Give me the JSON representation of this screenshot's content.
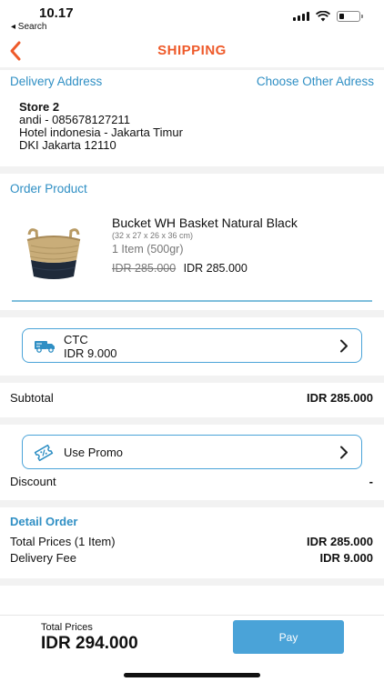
{
  "status_bar": {
    "time": "10.17",
    "back_app": "◂ Search"
  },
  "nav": {
    "title": "SHIPPING"
  },
  "delivery": {
    "section_label": "Delivery Address",
    "change_link": "Choose Other Adress",
    "store_name": "Store 2",
    "contact": "andi - 085678127211",
    "address_line1": "Hotel indonesia - Jakarta Timur",
    "address_line2": "DKI Jakarta 12110"
  },
  "order": {
    "section_label": "Order Product",
    "product": {
      "name": "Bucket WH Basket Natural Black",
      "dimensions": "(32 x 27 x 26 x 36 cm)",
      "quantity": "1 Item (500gr)",
      "original_price": "IDR 285.000",
      "price": "IDR 285.000"
    }
  },
  "courier": {
    "name": "CTC",
    "cost": "IDR 9.000"
  },
  "subtotal": {
    "label": "Subtotal",
    "value": "IDR 285.000"
  },
  "promo": {
    "label": "Use Promo"
  },
  "discount": {
    "label": "Discount",
    "value": "-"
  },
  "detail": {
    "section_label": "Detail Order",
    "total_prices_label": "Total Prices (1 Item)",
    "total_prices_value": "IDR 285.000",
    "delivery_fee_label": "Delivery Fee",
    "delivery_fee_value": "IDR 9.000"
  },
  "footer": {
    "total_label": "Total Prices",
    "total_value": "IDR 294.000",
    "pay_label": "Pay"
  },
  "colors": {
    "accent_blue": "#4aa3d8",
    "title_orange": "#ee5a2a",
    "section_blue": "#2f8fc4"
  }
}
